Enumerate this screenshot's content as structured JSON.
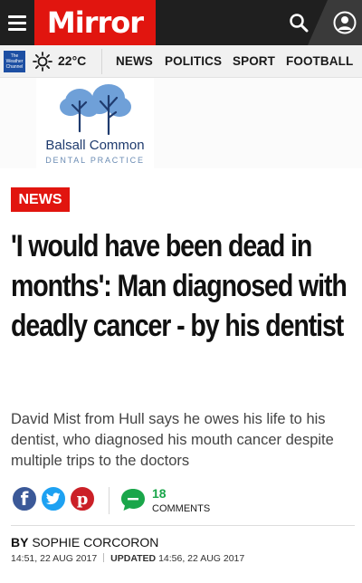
{
  "header": {
    "logo_text": "Mirror",
    "brand_color": "#e1150f",
    "menu_icon": "hamburger-icon",
    "search_icon": "search-icon",
    "account_icon": "user-icon"
  },
  "weather": {
    "provider_logo": "The Weather Channel",
    "icon": "sun-icon",
    "temperature": "22°C"
  },
  "nav": {
    "items": [
      {
        "label": "NEWS"
      },
      {
        "label": "POLITICS"
      },
      {
        "label": "SPORT"
      },
      {
        "label": "FOOTBALL"
      }
    ]
  },
  "ad": {
    "name": "Balsall Common",
    "subtitle": "DENTAL PRACTICE",
    "accent": "#1f3b6e",
    "tree_color": "#6fa0d8"
  },
  "article": {
    "section_badge": "NEWS",
    "headline": "'I would have been dead in months': Man diagnosed with deadly cancer - by his dentist",
    "standfirst": "David Mist from Hull says he owes his life to his dentist, who diagnosed his mouth cancer despite multiple trips to the doctors",
    "share": {
      "facebook_icon": "facebook-icon",
      "twitter_icon": "twitter-icon",
      "pinterest_icon": "pinterest-icon"
    },
    "comments": {
      "count": "18",
      "label": "COMMENTS",
      "accent": "#1aa64a"
    },
    "byline_prefix": "BY",
    "author": "SOPHIE CORCORON",
    "published": "14:51, 22 AUG 2017",
    "updated_label": "UPDATED",
    "updated": "14:56, 22 AUG 2017"
  }
}
